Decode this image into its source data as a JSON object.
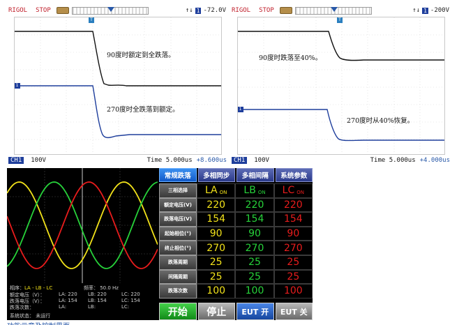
{
  "scope_left": {
    "brand": "RIGOL",
    "run_state": "STOP",
    "trigger_arrows": "↑↓",
    "trigger_source": "1",
    "trigger_level": "-72.0V",
    "annotation_top": "90度时额定到全跌落。",
    "annotation_bottom": "270度时全跌落到额定。",
    "ch_label": "CH1",
    "ch_scale": "100V",
    "timebase": "Time 5.000us",
    "offset": "+8.600us"
  },
  "scope_right": {
    "brand": "RIGOL",
    "run_state": "STOP",
    "trigger_arrows": "↑↓",
    "trigger_source": "1",
    "trigger_level": "-200V",
    "annotation_top": "90度时跌落至40%。",
    "annotation_bottom": "270度时从40%恢复。",
    "ch_label": "CH1",
    "ch_scale": "100V",
    "timebase": "Time 5.000us",
    "offset": "+4.000us"
  },
  "panel": {
    "tabs": [
      "常规跌落",
      "多相同步",
      "多相间隔",
      "系统参数"
    ],
    "rows": [
      {
        "label": "三相选择",
        "a": "LA",
        "b": "LB",
        "c": "LC",
        "suffix": "ON"
      },
      {
        "label": "额定电压(V)",
        "a": "220",
        "b": "220",
        "c": "220"
      },
      {
        "label": "跌落电压(V)",
        "a": "154",
        "b": "154",
        "c": "154"
      },
      {
        "label": "起始相位(°)",
        "a": "90",
        "b": "90",
        "c": "90"
      },
      {
        "label": "终止相位(°)",
        "a": "270",
        "b": "270",
        "c": "270"
      },
      {
        "label": "跌落周期",
        "a": "25",
        "b": "25",
        "c": "25"
      },
      {
        "label": "间隔周期",
        "a": "25",
        "b": "25",
        "c": "25"
      },
      {
        "label": "跌落次数",
        "a": "100",
        "b": "100",
        "c": "100"
      }
    ],
    "buttons": {
      "start": "开始",
      "stop": "停止",
      "eut_on": "EUT 开",
      "eut_off": "EUT 关"
    },
    "info": {
      "phase_seq_label": "相序：",
      "phase_seq": "LA - LB - LC",
      "freq": "频率：  50.0 Hz",
      "rated_label": "额定电压（V）：",
      "rated_la": "LA: 220",
      "rated_lb": "LB: 220",
      "rated_lc": "LC: 220",
      "drop_label": "跌落电压（V）：",
      "drop_la": "LA: 154",
      "drop_lb": "LB: 154",
      "drop_lc": "LC: 154",
      "count_label": "跌落次数：",
      "count_la": "LA:",
      "count_lb": "LB:",
      "count_lc": "LC:",
      "status": "系统状态：  未运行"
    },
    "colors": {
      "la": "#f2e21a",
      "lb": "#27d23a",
      "lc": "#e81c1c"
    }
  },
  "caption": "功能示意及控制界面"
}
